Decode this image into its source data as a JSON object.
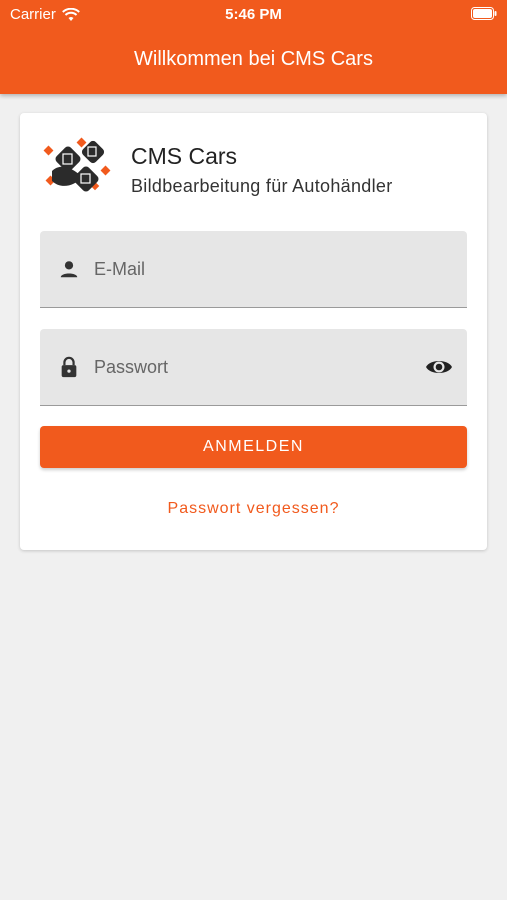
{
  "status_bar": {
    "carrier": "Carrier",
    "time": "5:46 PM"
  },
  "app_bar": {
    "title": "Willkommen bei CMS Cars"
  },
  "brand": {
    "name": "CMS Cars",
    "subtitle": "Bildbearbeitung für Autohändler"
  },
  "form": {
    "email_label": "E-Mail",
    "password_label": "Passwort",
    "login_button": "ANMELDEN",
    "forgot_link": "Passwort vergessen?"
  },
  "colors": {
    "accent": "#f15a1d",
    "background": "#f0f0f0",
    "field_bg": "#e6e6e6"
  },
  "icons": [
    "wifi-icon",
    "battery-icon",
    "person-icon",
    "lock-icon",
    "eye-icon"
  ]
}
